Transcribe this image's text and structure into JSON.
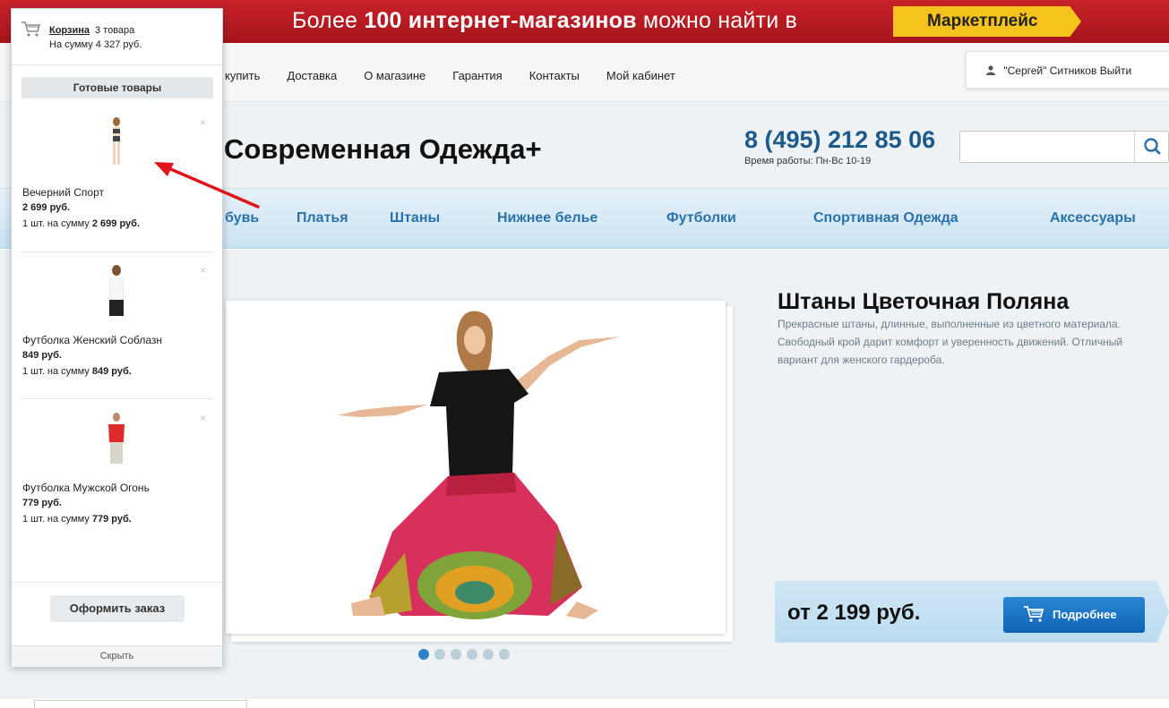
{
  "banner": {
    "text_prefix": "Более",
    "text_bold": "100 интернет-магазинов",
    "text_suffix": "можно найти в",
    "cta": "Маркетплейс"
  },
  "topnav": {
    "links": [
      "купить",
      "Доставка",
      "О магазине",
      "Гарантия",
      "Контакты",
      "Мой кабинет"
    ],
    "user": "\"Сергей\" Ситников",
    "logout": "Выйти"
  },
  "header": {
    "logo": "Современная Одежда+",
    "phone": "8 (495) 212 85 06",
    "hours": "Время работы: Пн-Вс 10-19",
    "search_placeholder": ""
  },
  "categories": [
    "бувь",
    "Платья",
    "Штаны",
    "Нижнее белье",
    "Футболки",
    "Спортивная Одежда",
    "Аксессуары"
  ],
  "product": {
    "title": "Штаны Цветочная Поляна",
    "description": "Прекрасные штаны, длинные, выполненные из цветного материала. Свободный крой дарит комфорт и уверенность движений. Отличный вариант для женского гардероба.",
    "price": "от 2 199 руб.",
    "details_button": "Подробнее",
    "slides_total": 6,
    "active_slide": 1
  },
  "cart": {
    "link": "Корзина",
    "count": "3 товара",
    "sum": "На сумму 4 327 руб.",
    "section": "Готовые товары",
    "items": [
      {
        "name": "Вечерний Спорт",
        "price": "2 699 руб.",
        "qty_prefix": "1 шт. на сумму",
        "qty_sum": "2 699 руб."
      },
      {
        "name": "Футболка Женский Соблазн",
        "price": "849 руб.",
        "qty_prefix": "1 шт. на сумму",
        "qty_sum": "849 руб."
      },
      {
        "name": "Футболка Мужской Огонь",
        "price": "779 руб.",
        "qty_prefix": "1 шт. на сумму",
        "qty_sum": "779 руб."
      }
    ],
    "close_glyph": "×",
    "order_button": "Оформить заказ",
    "hide": "Скрыть"
  },
  "colors": {
    "banner": "#b81a22",
    "accent": "#2b72aa",
    "cta": "#f6c21c",
    "button": "#1a72c6"
  }
}
